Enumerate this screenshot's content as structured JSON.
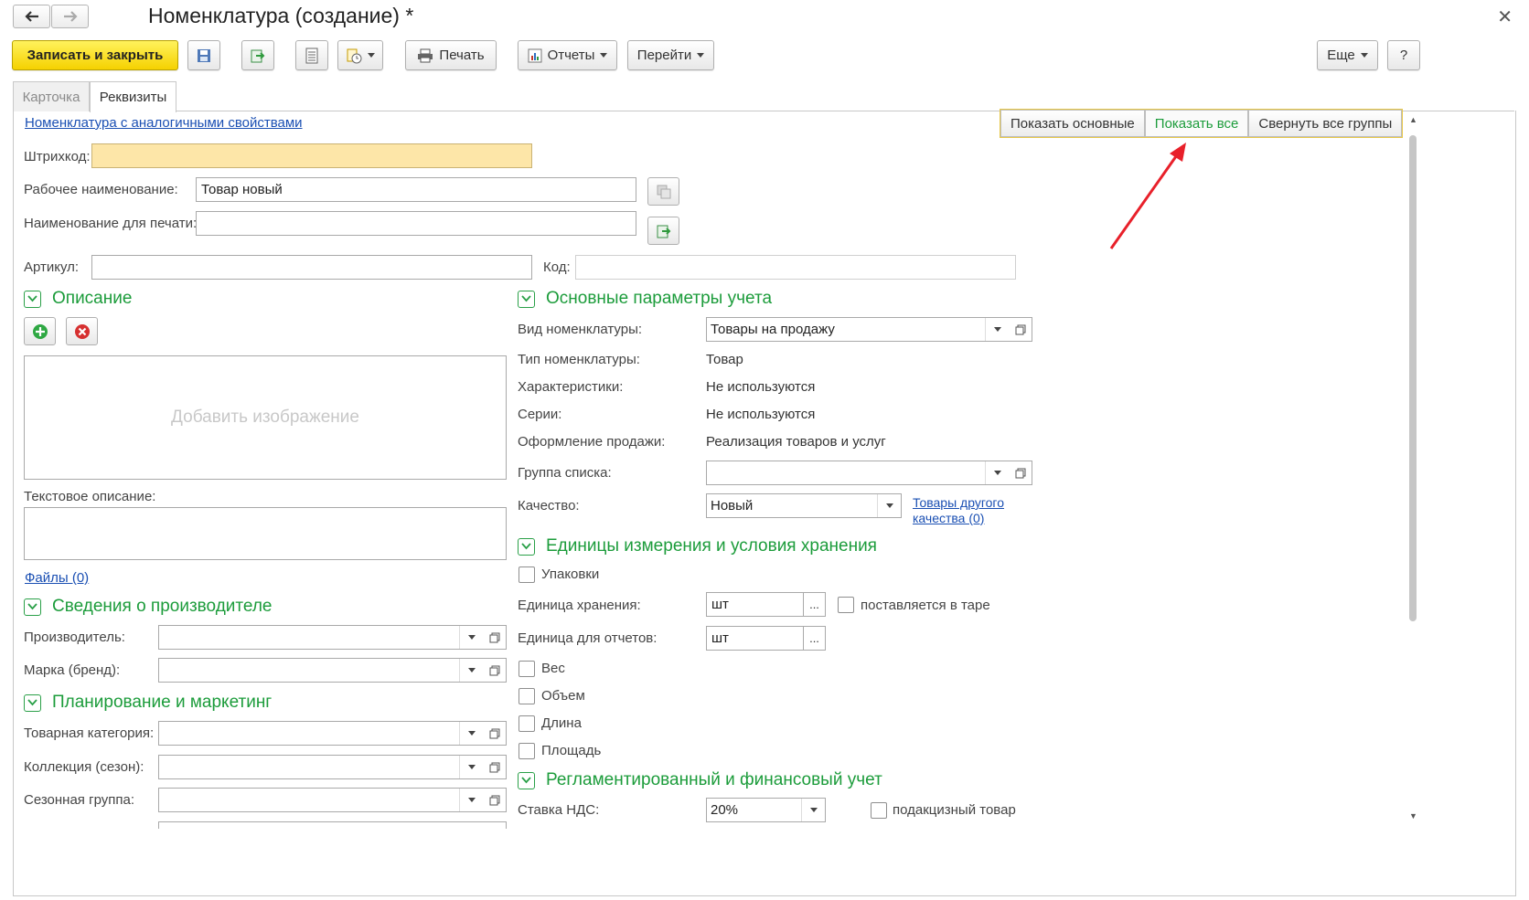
{
  "window": {
    "title": "Номенклатура (создание) *"
  },
  "toolbar": {
    "save_close": "Записать и закрыть",
    "print": "Печать",
    "reports": "Отчеты",
    "goto": "Перейти",
    "more": "Еще",
    "help": "?"
  },
  "tabs": [
    {
      "label": "Карточка"
    },
    {
      "label": "Реквизиты"
    }
  ],
  "view_buttons": {
    "show_main": "Показать основные",
    "show_all": "Показать все",
    "collapse": "Свернуть все группы"
  },
  "links": {
    "similar": "Номенклатура с аналогичными свойствами",
    "files": "Файлы (0)",
    "other_quality_1": "Товары другого",
    "other_quality_2": "качества (0)"
  },
  "fields": {
    "barcode_label": "Штрихкод:",
    "work_name_label": "Рабочее наименование:",
    "work_name_value": "Товар новый",
    "print_name_label": "Наименование для печати:",
    "article_label": "Артикул:",
    "code_label": "Код:"
  },
  "description": {
    "title": "Описание",
    "add_image": "Добавить изображение",
    "text_label": "Текстовое описание:"
  },
  "manufacturer": {
    "title": "Сведения о производителе",
    "maker_label": "Производитель:",
    "brand_label": "Марка (бренд):"
  },
  "planning": {
    "title": "Планирование и маркетинг",
    "category_label": "Товарная категория:",
    "collection_label": "Коллекция (сезон):",
    "season_label": "Сезонная группа:"
  },
  "accounting": {
    "title": "Основные параметры учета",
    "kind_label": "Вид номенклатуры:",
    "kind_value": "Товары на продажу",
    "type_label": "Тип номенклатуры:",
    "type_value": "Товар",
    "chars_label": "Характеристики:",
    "chars_value": "Не используются",
    "series_label": "Серии:",
    "series_value": "Не используются",
    "sale_label": "Оформление продажи:",
    "sale_value": "Реализация товаров и услуг",
    "list_group_label": "Группа списка:",
    "quality_label": "Качество:",
    "quality_value": "Новый"
  },
  "units": {
    "title": "Единицы измерения и условия хранения",
    "packages": "Упаковки",
    "storage_label": "Единица хранения:",
    "storage_value": "шт",
    "tare": "поставляется в таре",
    "report_label": "Единица для отчетов:",
    "report_value": "шт",
    "weight": "Вес",
    "volume": "Объем",
    "length": "Длина",
    "area": "Площадь",
    "ellipsis": "..."
  },
  "reg": {
    "title": "Регламентированный и финансовый учет",
    "vat_label": "Ставка НДС:",
    "vat_value": "20%",
    "excise": "подакцизный товар"
  },
  "colors": {
    "accent": "#1c9c3b",
    "primary": "#f5d100",
    "arrow": "#e8202a",
    "barcode_bg": "#fde6a8"
  }
}
